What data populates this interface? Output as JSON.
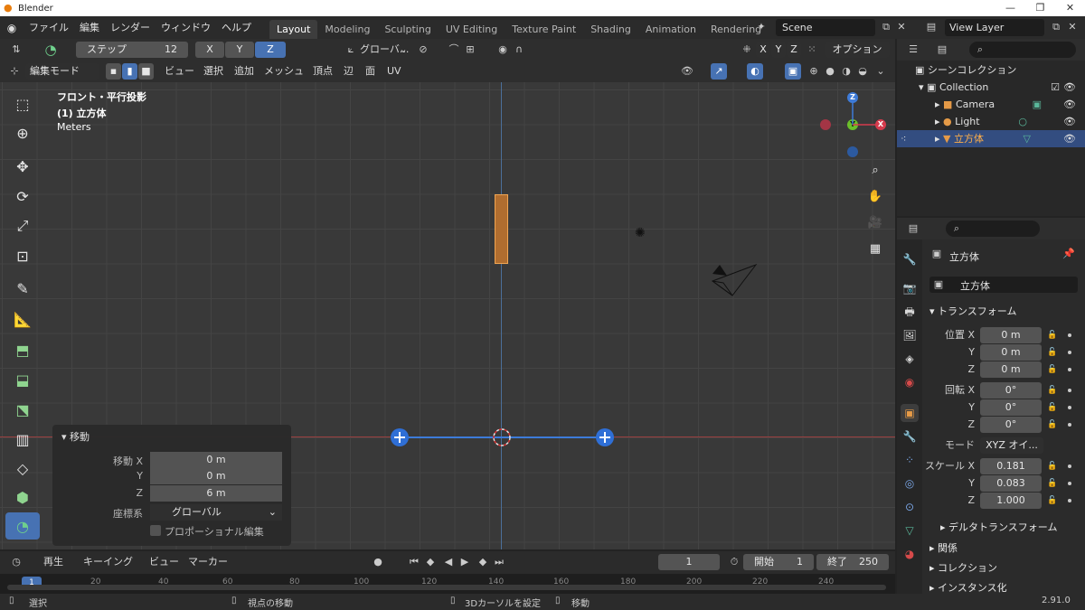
{
  "window": {
    "title": "Blender",
    "controls": [
      "—",
      "❐",
      "✕"
    ]
  },
  "menubar": {
    "items": [
      "ファイル",
      "編集",
      "レンダー",
      "ウィンドウ",
      "ヘルプ"
    ]
  },
  "workspaces": [
    "Layout",
    "Modeling",
    "Sculpting",
    "UV Editing",
    "Texture Paint",
    "Shading",
    "Animation",
    "Rendering"
  ],
  "active_workspace": "Layout",
  "scene": "Scene",
  "view_layer": "View Layer",
  "tool_header": {
    "step_label": "ステップ",
    "step_value": "12",
    "x": "X",
    "y": "Y",
    "z": "Z",
    "transform_orientation": "グローバ...",
    "options": "オプション"
  },
  "viewport_header": {
    "mode": "編集モード",
    "menus": [
      "ビュー",
      "選択",
      "追加",
      "メッシュ",
      "頂点",
      "辺",
      "面",
      "UV"
    ]
  },
  "viewport_overlay": {
    "view_name": "フロント・平行投影",
    "object": "(1) 立方体",
    "units": "Meters"
  },
  "gizmo": {
    "z": "Z",
    "y": "Y",
    "x": "X"
  },
  "operator_panel": {
    "title": "移動",
    "rows": [
      {
        "label": "移動 X",
        "value": "0 m"
      },
      {
        "label": "Y",
        "value": "0 m"
      },
      {
        "label": "Z",
        "value": "6 m"
      }
    ],
    "orientation_label": "座標系",
    "orientation_value": "グローバル",
    "proportional": "プロポーショナル編集"
  },
  "timeline": {
    "menus": [
      "再生",
      "キーイング",
      "ビュー",
      "マーカー"
    ],
    "current_frame": "1",
    "start_label": "開始",
    "start": "1",
    "end_label": "終了",
    "end": "250",
    "ticks": [
      "20",
      "40",
      "60",
      "80",
      "100",
      "120",
      "140",
      "160",
      "180",
      "200",
      "220",
      "240"
    ],
    "marker": "1"
  },
  "statusbar": {
    "select": "選択",
    "rotate_view": "視点の移動",
    "set_cursor": "3Dカーソルを設定",
    "move": "移動",
    "version": "2.91.0"
  },
  "outliner": {
    "root": "シーンコレクション",
    "items": [
      {
        "name": "Collection"
      },
      {
        "name": "Camera"
      },
      {
        "name": "Light"
      },
      {
        "name": "立方体"
      }
    ]
  },
  "properties": {
    "object_name": "立方体",
    "data_name": "立方体",
    "transform_section": "トランスフォーム",
    "location_label": "位置 X",
    "location": [
      "0 m",
      "0 m",
      "0 m"
    ],
    "rotation_label": "回転 X",
    "rotation": [
      "0°",
      "0°",
      "0°"
    ],
    "mode_label": "モード",
    "mode_value": "XYZ オイ...",
    "scale_label": "スケール X",
    "scale": [
      "0.181",
      "0.083",
      "1.000"
    ],
    "axis_y": "Y",
    "axis_z": "Z",
    "delta_section": "デルタトランスフォーム",
    "relations": "関係",
    "collections": "コレクション",
    "instancing": "インスタンス化"
  },
  "colors": {
    "accent": "#4772b3",
    "selection": "#334d80",
    "object_orange": "#f1a552"
  }
}
